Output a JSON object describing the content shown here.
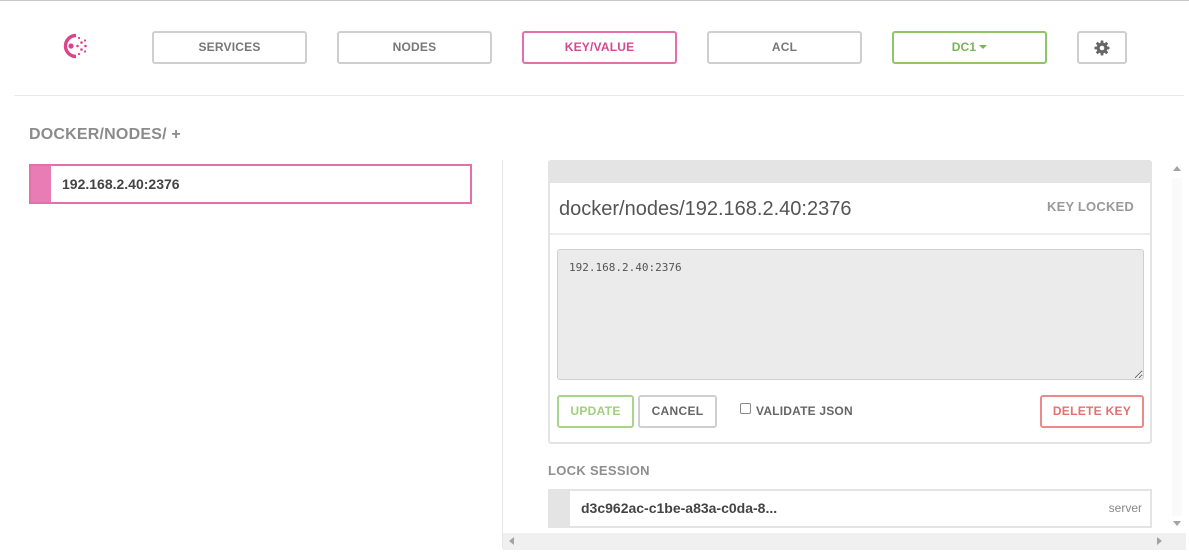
{
  "nav": {
    "logo_icon": "consul-logo-icon",
    "services_label": "SERVICES",
    "nodes_label": "NODES",
    "keyvalue_label": "KEY/VALUE",
    "acl_label": "ACL",
    "datacenter_label": "DC1",
    "settings_icon": "gear-icon",
    "accent_color": "#e46fab",
    "datacenter_color": "#7ab356"
  },
  "breadcrumb": {
    "path": "DOCKER/NODES/",
    "add_label": "+"
  },
  "keys": {
    "items": [
      {
        "label": "192.168.2.40:2376",
        "selected": true
      }
    ]
  },
  "editor": {
    "key_path": "docker/nodes/192.168.2.40:2376",
    "lock_status": "KEY LOCKED",
    "value": "192.168.2.40:2376",
    "update_label": "UPDATE",
    "cancel_label": "CANCEL",
    "validate_json_label": "VALIDATE JSON",
    "validate_json_checked": false,
    "delete_label": "DELETE KEY"
  },
  "lock_session": {
    "title": "LOCK SESSION",
    "session_id": "d3c962ac-c1be-a83a-c0da-8...",
    "node_role": "server"
  }
}
